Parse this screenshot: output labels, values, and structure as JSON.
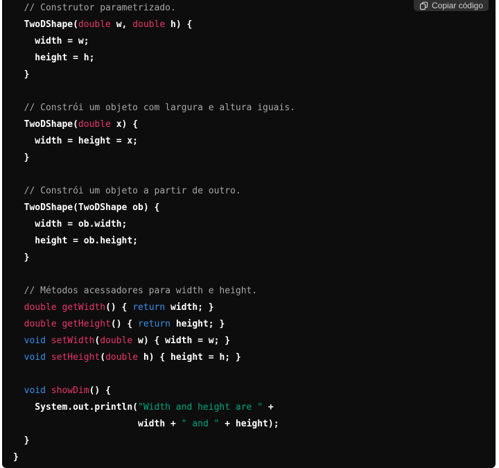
{
  "copy_button": {
    "label": "Copiar código",
    "icon": "copy-icon"
  },
  "colors": {
    "background": "#0d0d0d",
    "comment": "#a7a7a7",
    "keyword": "#e9366b",
    "keyword_blue": "#3b8eea",
    "string": "#00a67d",
    "plain": "#ffffff"
  },
  "code_lines": [
    [
      [
        "comment",
        "  // Construtor parametrizado."
      ]
    ],
    [
      [
        "plain",
        "  TwoDShape("
      ],
      [
        "kw",
        "double"
      ],
      [
        "plain",
        " w, "
      ],
      [
        "kw",
        "double"
      ],
      [
        "plain",
        " h) {"
      ]
    ],
    [
      [
        "plain",
        "    width = w;"
      ]
    ],
    [
      [
        "plain",
        "    height = h;"
      ]
    ],
    [
      [
        "plain",
        "  }"
      ]
    ],
    [
      [
        "plain",
        ""
      ]
    ],
    [
      [
        "comment",
        "  // Constrói um objeto com largura e altura iguais."
      ]
    ],
    [
      [
        "plain",
        "  TwoDShape("
      ],
      [
        "kw",
        "double"
      ],
      [
        "plain",
        " x) {"
      ]
    ],
    [
      [
        "plain",
        "    width = height = x;"
      ]
    ],
    [
      [
        "plain",
        "  }"
      ]
    ],
    [
      [
        "plain",
        ""
      ]
    ],
    [
      [
        "comment",
        "  // Constrói um objeto a partir de outro."
      ]
    ],
    [
      [
        "plain",
        "  TwoDShape(TwoDShape ob) {"
      ]
    ],
    [
      [
        "plain",
        "    width = ob.width;"
      ]
    ],
    [
      [
        "plain",
        "    height = ob.height;"
      ]
    ],
    [
      [
        "plain",
        "  }"
      ]
    ],
    [
      [
        "plain",
        ""
      ]
    ],
    [
      [
        "comment",
        "  // Métodos acessadores para width e height."
      ]
    ],
    [
      [
        "plain",
        "  "
      ],
      [
        "kw",
        "double"
      ],
      [
        "plain",
        " "
      ],
      [
        "fn",
        "getWidth"
      ],
      [
        "plain",
        "() { "
      ],
      [
        "kw2",
        "return"
      ],
      [
        "plain",
        " width; }"
      ]
    ],
    [
      [
        "plain",
        "  "
      ],
      [
        "kw",
        "double"
      ],
      [
        "plain",
        " "
      ],
      [
        "fn",
        "getHeight"
      ],
      [
        "plain",
        "() { "
      ],
      [
        "kw2",
        "return"
      ],
      [
        "plain",
        " height; }"
      ]
    ],
    [
      [
        "plain",
        "  "
      ],
      [
        "kw2",
        "void"
      ],
      [
        "plain",
        " "
      ],
      [
        "fn",
        "setWidth"
      ],
      [
        "plain",
        "("
      ],
      [
        "kw",
        "double"
      ],
      [
        "plain",
        " w) { width = w; }"
      ]
    ],
    [
      [
        "plain",
        "  "
      ],
      [
        "kw2",
        "void"
      ],
      [
        "plain",
        " "
      ],
      [
        "fn",
        "setHeight"
      ],
      [
        "plain",
        "("
      ],
      [
        "kw",
        "double"
      ],
      [
        "plain",
        " h) { height = h; }"
      ]
    ],
    [
      [
        "plain",
        ""
      ]
    ],
    [
      [
        "plain",
        "  "
      ],
      [
        "kw2",
        "void"
      ],
      [
        "plain",
        " "
      ],
      [
        "fn",
        "showDim"
      ],
      [
        "plain",
        "() {"
      ]
    ],
    [
      [
        "plain",
        "    System.out.println("
      ],
      [
        "str",
        "\"Width and height are \""
      ],
      [
        "plain",
        " +"
      ]
    ],
    [
      [
        "plain",
        "                       width + "
      ],
      [
        "str",
        "\" and \""
      ],
      [
        "plain",
        " + height);"
      ]
    ],
    [
      [
        "plain",
        "  }"
      ]
    ],
    [
      [
        "plain",
        "}"
      ]
    ]
  ]
}
